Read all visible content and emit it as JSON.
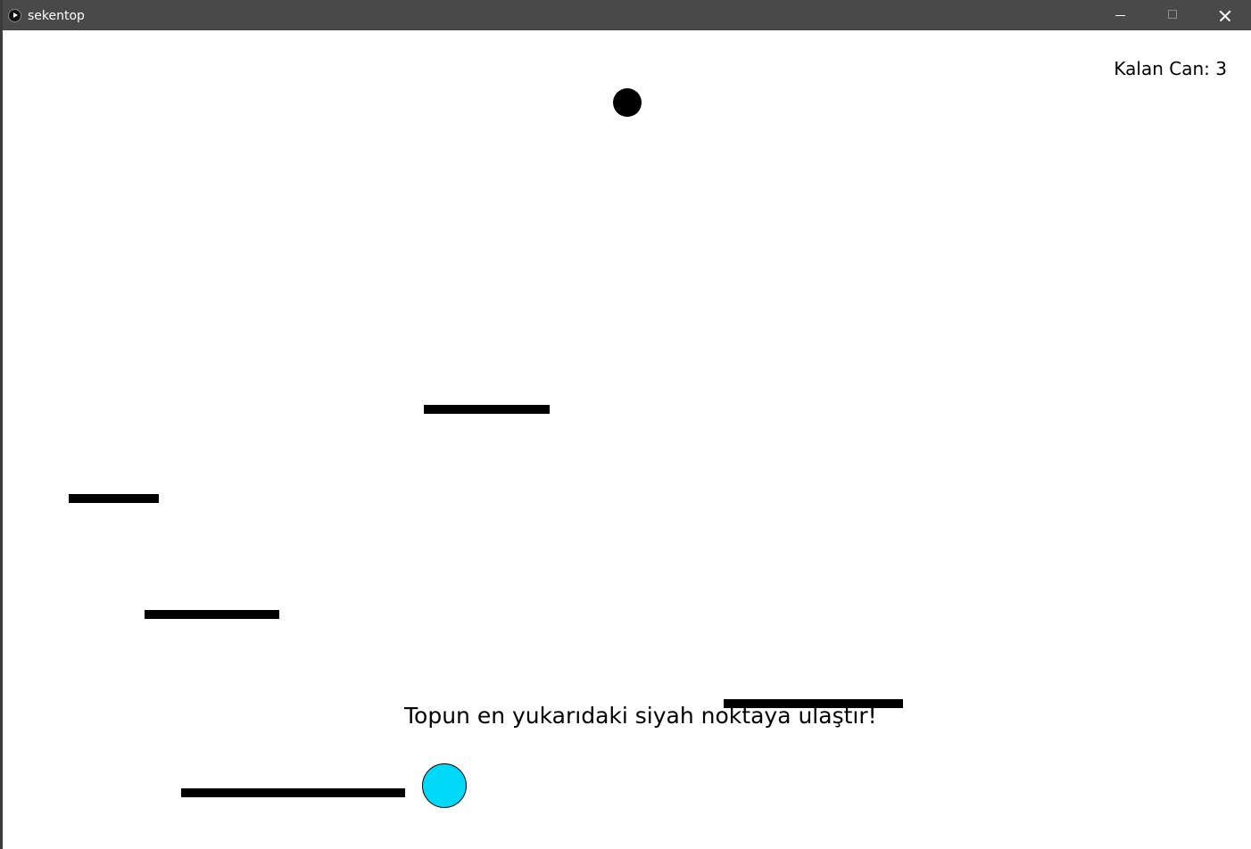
{
  "window": {
    "title": "sekentop",
    "icon": "play-icon",
    "controls": [
      "minimize-icon",
      "maximize-icon",
      "close-icon"
    ]
  },
  "game": {
    "lives_text": "Kalan Can: 3",
    "instruction_text": "Topun en yukarıdaki siyah noktaya ulaştır!",
    "colors": {
      "background": "#ffffff",
      "platforms": "#000000",
      "target": "#000000",
      "player_ball": "#00d8f8"
    }
  }
}
